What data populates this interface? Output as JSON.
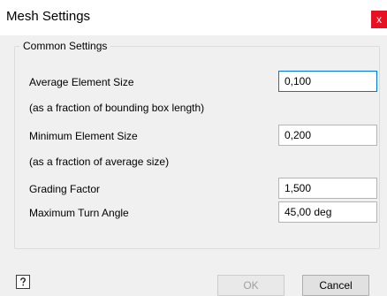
{
  "window": {
    "title": "Mesh Settings",
    "close_glyph": "x"
  },
  "group": {
    "title": "Common Settings",
    "rows": [
      {
        "label": "Average Element Size",
        "value": "0,100"
      },
      {
        "label": "(as a fraction of bounding box length)"
      },
      {
        "label": "Minimum Element Size",
        "value": "0,200"
      },
      {
        "label": "(as a fraction of average size)"
      },
      {
        "label": "Grading Factor",
        "value": "1,500"
      },
      {
        "label": "Maximum Turn Angle",
        "value": "45,00 deg"
      }
    ]
  },
  "footer": {
    "ok_label": "OK",
    "cancel_label": "Cancel",
    "help_icon": "help-icon"
  }
}
